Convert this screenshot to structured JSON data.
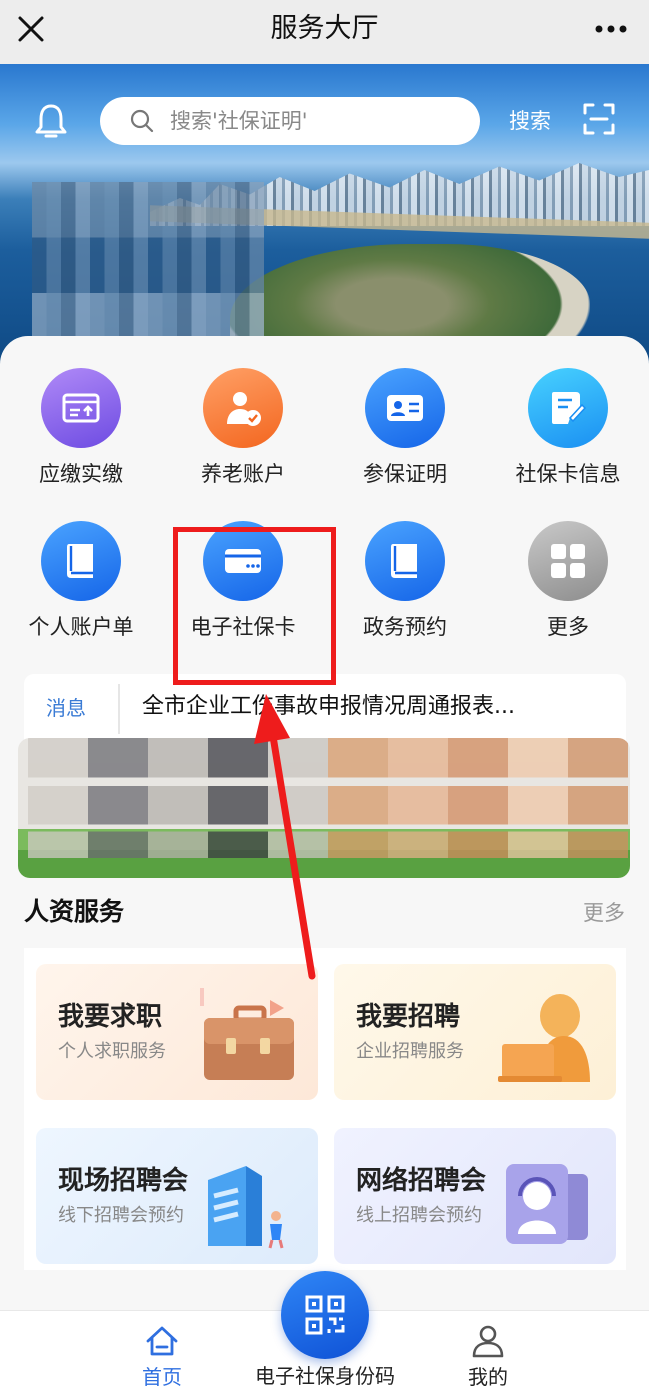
{
  "titlebar": {
    "title": "服务大厅"
  },
  "banner": {
    "search_placeholder": "搜索'社保证明'",
    "search_button": "搜索"
  },
  "services_row1": [
    {
      "label": "应缴实缴",
      "icon": "payment-card-icon",
      "color": "#7c56e8"
    },
    {
      "label": "养老账户",
      "icon": "user-check-icon",
      "color": "#f3661f"
    },
    {
      "label": "参保证明",
      "icon": "id-card-icon",
      "color": "#1565e8"
    },
    {
      "label": "社保卡信息",
      "icon": "edit-doc-icon",
      "color": "#1a8ff2"
    }
  ],
  "services_row2": [
    {
      "label": "个人账户单",
      "icon": "book-icon",
      "color": "#1565e8"
    },
    {
      "label": "电子社保卡",
      "icon": "bank-card-icon",
      "color": "#1565e8"
    },
    {
      "label": "政务预约",
      "icon": "book-icon",
      "color": "#1565e8"
    },
    {
      "label": "更多",
      "icon": "grid-icon",
      "color": "#8d8d8d"
    }
  ],
  "news": {
    "tag": "消息",
    "text": "全市企业工伤事故申报情况周通报表..."
  },
  "hr_section": {
    "title": "人资服务",
    "more": "更多"
  },
  "cards": [
    {
      "title": "我要求职",
      "subtitle": "个人求职服务"
    },
    {
      "title": "我要招聘",
      "subtitle": "企业招聘服务"
    },
    {
      "title": "现场招聘会",
      "subtitle": "线下招聘会预约"
    },
    {
      "title": "网络招聘会",
      "subtitle": "线上招聘会预约"
    }
  ],
  "bottom_nav": {
    "home": "首页",
    "qr": "电子社保身份码",
    "mine": "我的",
    "active_color": "#2f6fe0"
  },
  "annotation": {
    "color": "#ee1c1c"
  }
}
